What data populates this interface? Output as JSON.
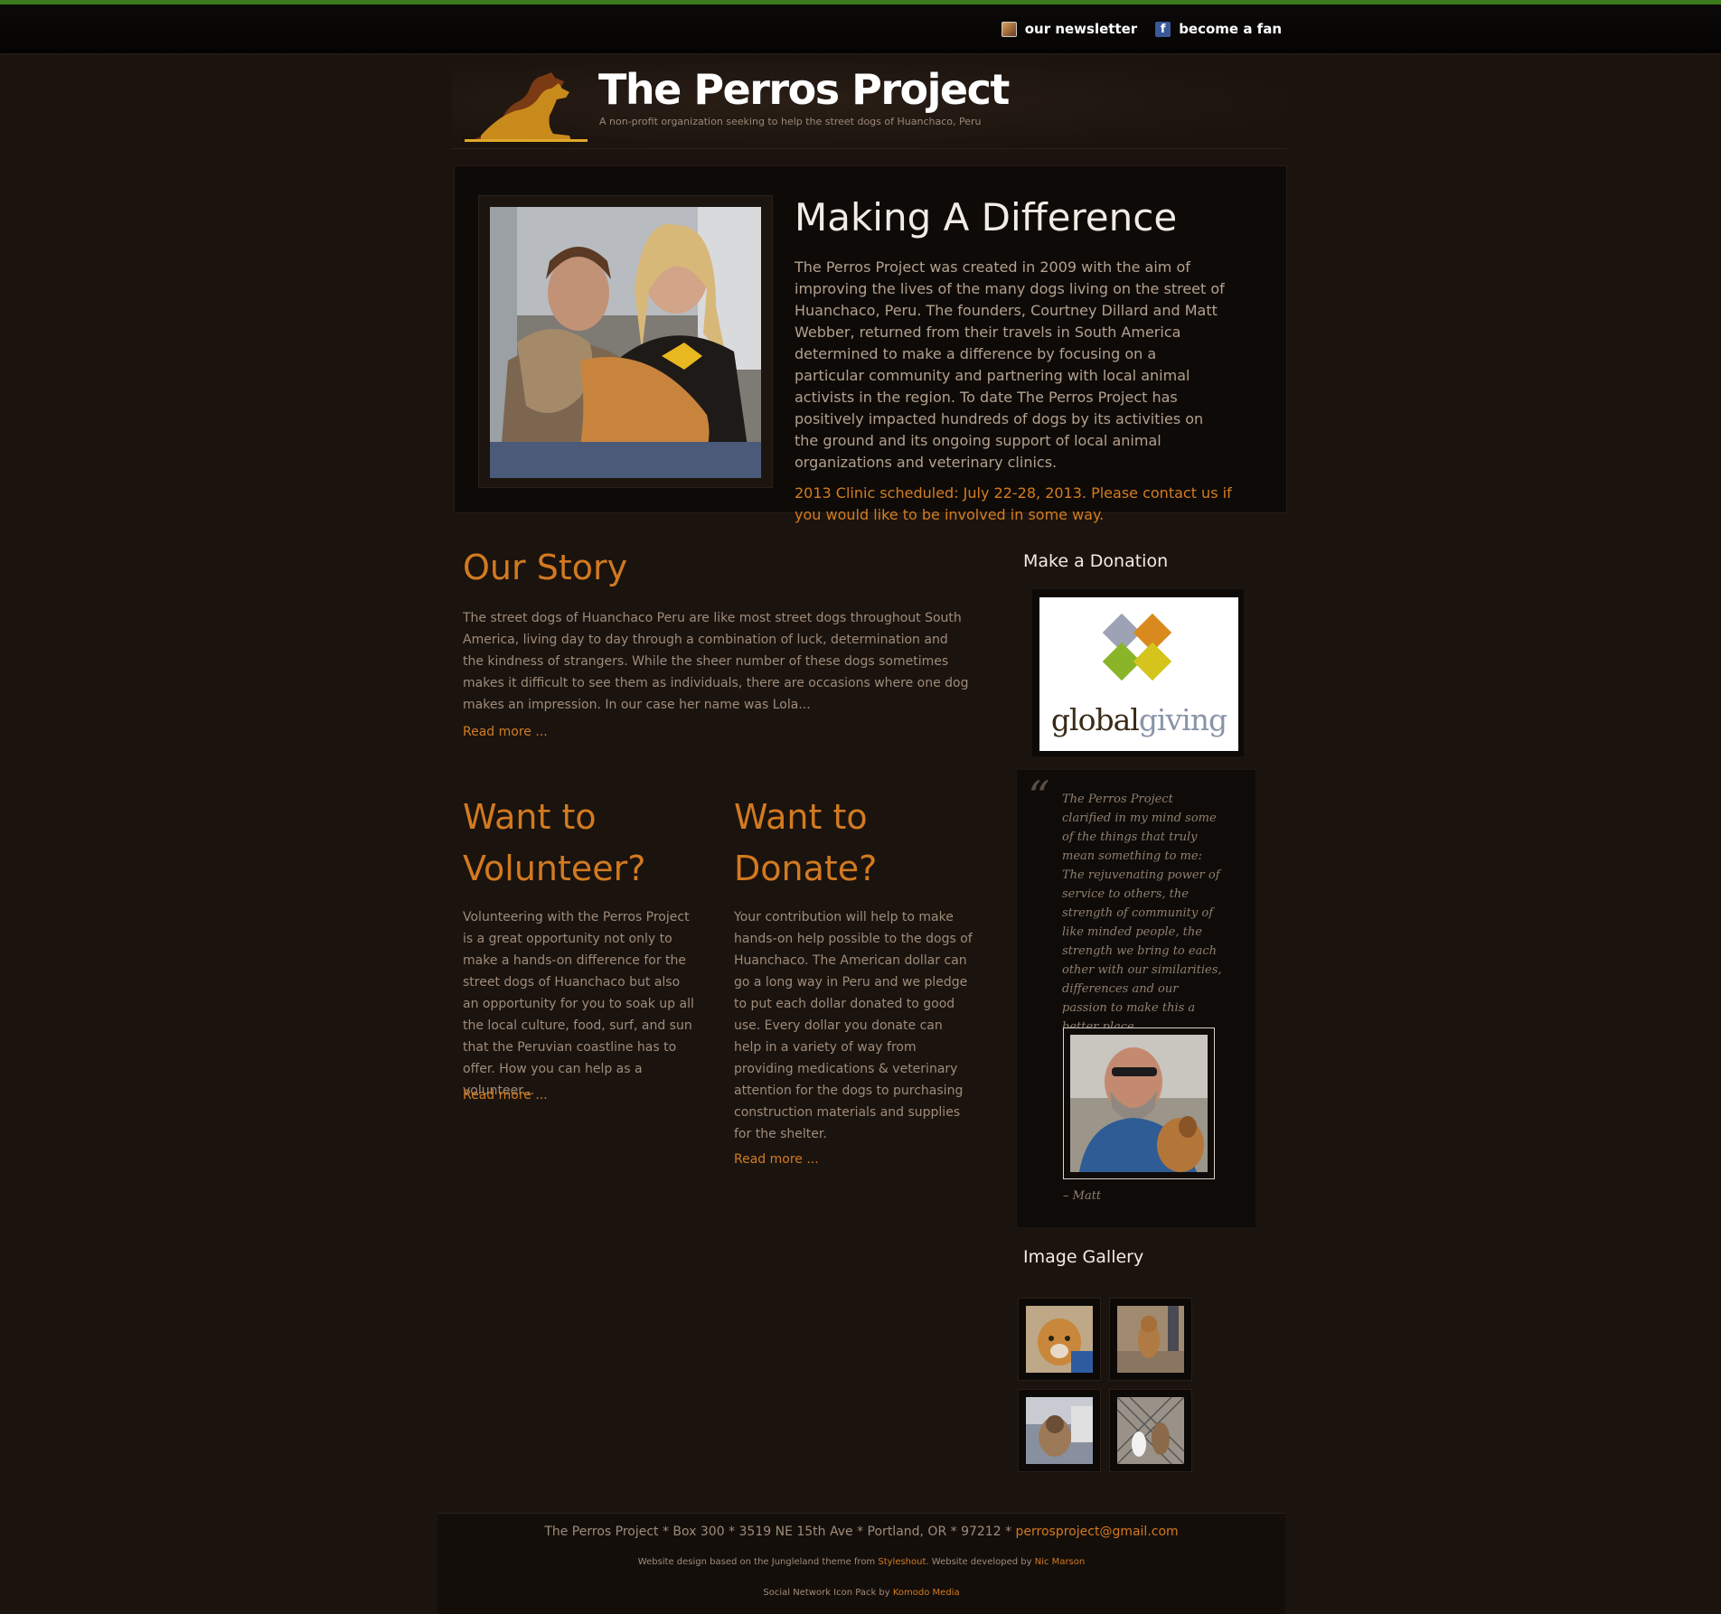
{
  "topbar": {
    "newsletter_label": "our newsletter",
    "fan_label": "become a fan"
  },
  "header": {
    "title": "The Perros Project",
    "tagline": "A non-profit organization seeking to help the street dogs of Huanchaco, Peru"
  },
  "intro": {
    "heading": "Making A Difference",
    "body": "The Perros Project was created in 2009 with the aim of improving the lives of the many dogs living on the street of Huanchaco, Peru. The founders, Courtney Dillard and Matt Webber, returned from their travels in South America determined to make a difference by focusing on a particular community and partnering with local animal activists in the region. To date The Perros Project has positively impacted hundreds of dogs by its activities on the ground and its ongoing support of local animal organizations and veterinary clinics.",
    "note": "2013 Clinic scheduled: July 22-28, 2013. Please contact us if you would like to be involved in some way."
  },
  "story": {
    "heading": "Our Story",
    "body": "The street dogs of Huanchaco Peru are like most street dogs throughout South America, living day to day through a combination of luck, determination and the kindness of strangers. While the sheer number of these dogs sometimes makes it difficult to see them as individuals, there are occasions where one dog makes an impression. In our case her name was Lola...",
    "read_more": "Read more ..."
  },
  "volunteer": {
    "heading": "Want to Volunteer?",
    "body": "Volunteering with the Perros Project is a great opportunity not only to make a hands-on difference for the street dogs of Huanchaco but also an opportunity for you to soak up all the local culture, food, surf, and sun that the Peruvian coastline has to offer. How you can help as a volunteer...",
    "read_more": "Read more ..."
  },
  "donate": {
    "heading": "Want to Donate?",
    "body": "Your contribution will help to make hands-on help possible to the dogs of Huanchaco. The American dollar can go a long way in Peru and we pledge to put each dollar donated to good use. Every dollar you donate can help in a variety of way from providing medications & veterinary attention for the dogs to purchasing construction materials and supplies for the shelter.",
    "read_more": "Read more ..."
  },
  "sidebar": {
    "donation_heading": "Make a Donation",
    "globalgiving_part1": "global",
    "globalgiving_part2": "giving",
    "quote_mark": "“",
    "quote": "The Perros Project clarified in my mind some of the things that truly mean something to me: The rejuvenating power of service to others, the strength of community of like minded people, the strength we bring to each other with our similarities, differences and our passion to make this a better place.",
    "quote_attribution": "– Matt",
    "gallery_heading": "Image Gallery"
  },
  "footer": {
    "address": "The Perros Project * Box 300 * 3519 NE 15th Ave * Portland, OR * 97212 * ",
    "email": "perrosproject@gmail.com",
    "credit_prefix": "Website design based on the Jungleland theme from ",
    "credit_styleshout": "Styleshout",
    "credit_mid": ". Website developed by ",
    "credit_dev": "Nic Marson",
    "icons_prefix": "Social Network Icon Pack by ",
    "icons_link": "Komodo Media"
  },
  "colors": {
    "accent": "#d27a20",
    "background": "#1b130e",
    "topbar_stripe": "#3c7a1e"
  }
}
